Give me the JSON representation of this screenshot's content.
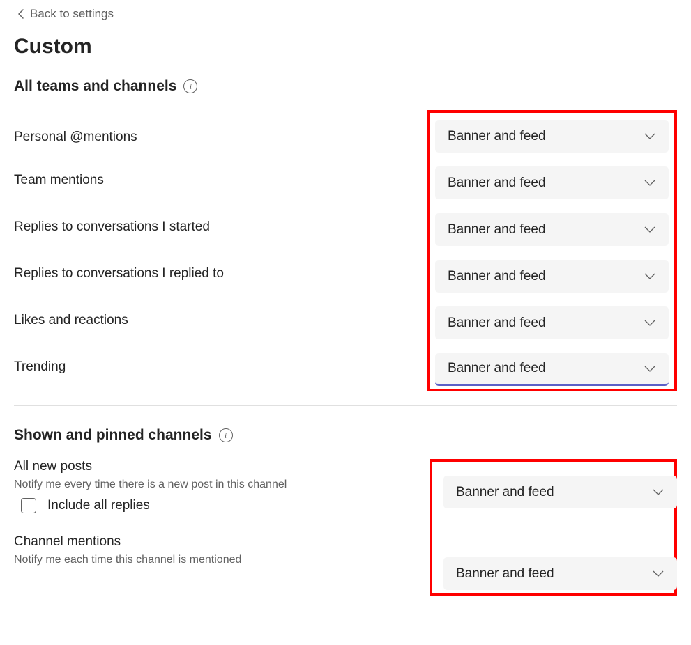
{
  "back_label": "Back to settings",
  "page_title": "Custom",
  "section1": {
    "title": "All teams and channels",
    "items": [
      {
        "label": "Personal @mentions",
        "value": "Banner and feed"
      },
      {
        "label": "Team mentions",
        "value": "Banner and feed"
      },
      {
        "label": "Replies to conversations I started",
        "value": "Banner and feed"
      },
      {
        "label": "Replies to conversations I replied to",
        "value": "Banner and feed"
      },
      {
        "label": "Likes and reactions",
        "value": "Banner and feed"
      },
      {
        "label": "Trending",
        "value": "Banner and feed"
      }
    ]
  },
  "section2": {
    "title": "Shown and pinned channels",
    "all_new_posts": {
      "label": "All new posts",
      "description": "Notify me every time there is a new post in this channel",
      "value": "Banner and feed"
    },
    "include_replies_label": "Include all replies",
    "channel_mentions": {
      "label": "Channel mentions",
      "description": "Notify me each time this channel is mentioned",
      "value": "Banner and feed"
    }
  }
}
